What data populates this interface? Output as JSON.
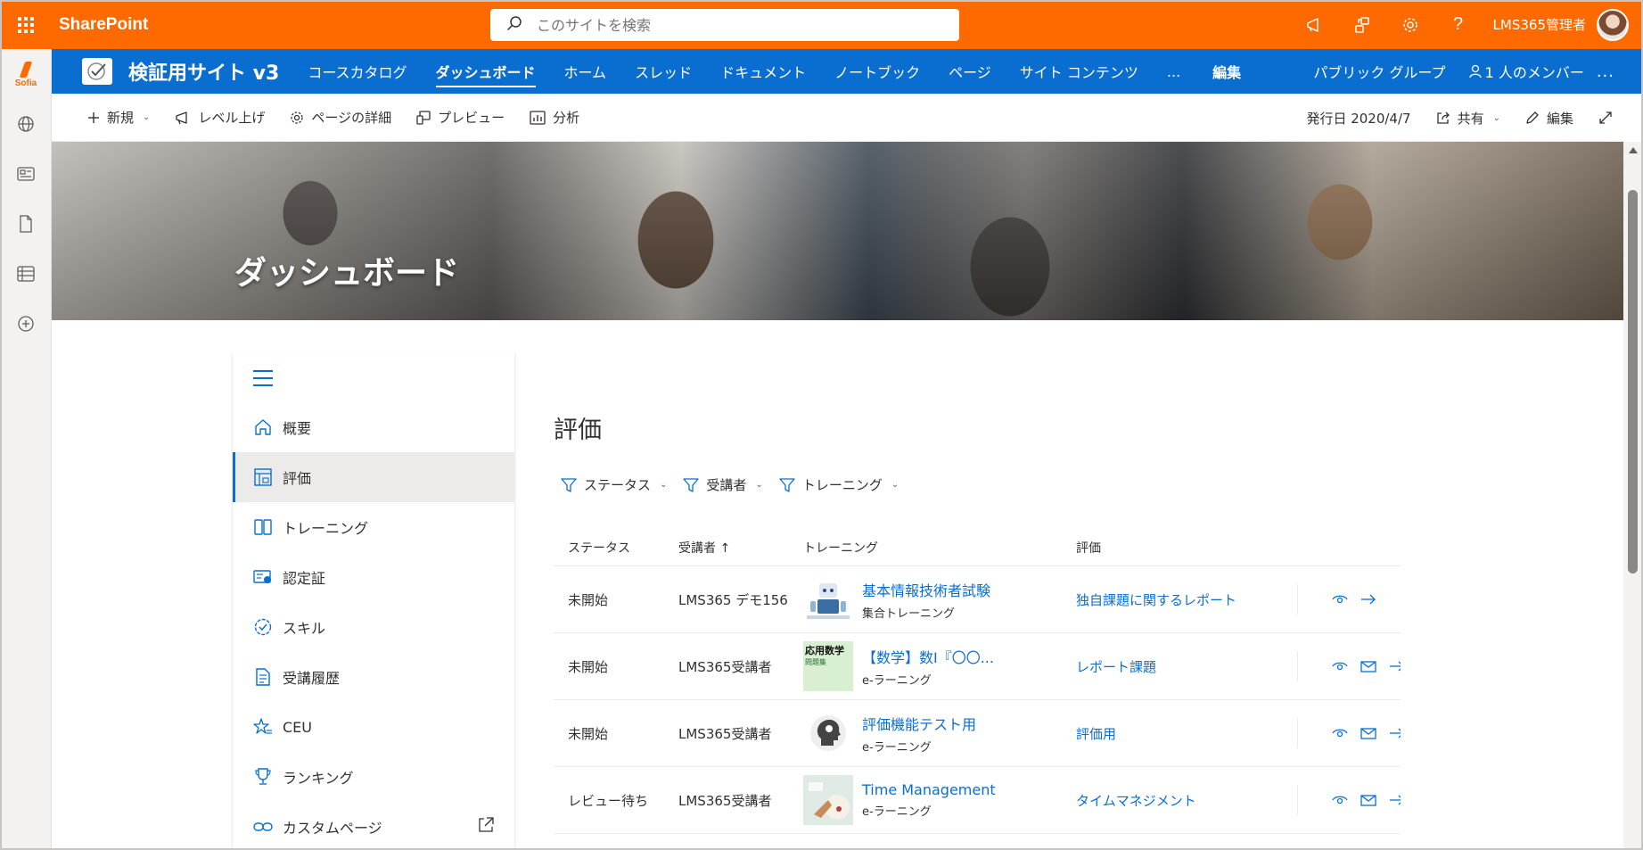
{
  "colors": {
    "suite_accent": "#ff6a00",
    "site_blue": "#0a6ed1",
    "link_blue": "#0a6ed1"
  },
  "suitebar": {
    "brand": "SharePoint",
    "search_placeholder": "このサイトを検索",
    "user_name": "LMS365管理者",
    "icons": [
      "waffle-icon",
      "megaphone-icon",
      "share-icon",
      "gear-icon",
      "help-icon"
    ]
  },
  "appbar": {
    "logo_text": "Sofia",
    "icons": [
      "globe-icon",
      "news-icon",
      "document-icon",
      "list-icon",
      "add-circle-icon"
    ]
  },
  "site": {
    "title": "検証用サイト v3",
    "nav": [
      {
        "label": "コースカタログ"
      },
      {
        "label": "ダッシュボード",
        "active": true
      },
      {
        "label": "ホーム"
      },
      {
        "label": "スレッド"
      },
      {
        "label": "ドキュメント"
      },
      {
        "label": "ノートブック"
      },
      {
        "label": "ページ"
      },
      {
        "label": "サイト コンテンツ"
      },
      {
        "label": "..."
      }
    ],
    "edit_label": "編集",
    "group_label": "パブリック グループ",
    "members_label": "1 人のメンバー",
    "more_label": "..."
  },
  "commandbar": {
    "new_label": "新規",
    "promote_label": "レベル上げ",
    "page_details_label": "ページの詳細",
    "preview_label": "プレビュー",
    "analytics_label": "分析",
    "published_label": "発行日 2020/4/7",
    "share_label": "共有",
    "edit_label": "編集"
  },
  "hero": {
    "title": "ダッシュボード"
  },
  "sidemenu": {
    "items": [
      {
        "label": "概要",
        "icon": "home-icon"
      },
      {
        "label": "評価",
        "icon": "assessment-icon",
        "active": true
      },
      {
        "label": "トレーニング",
        "icon": "book-icon"
      },
      {
        "label": "認定証",
        "icon": "certificate-icon"
      },
      {
        "label": "スキル",
        "icon": "skill-badge-icon"
      },
      {
        "label": "受講履歴",
        "icon": "history-icon"
      },
      {
        "label": "CEU",
        "icon": "star-list-icon"
      },
      {
        "label": "ランキング",
        "icon": "trophy-icon"
      },
      {
        "label": "カスタムページ",
        "icon": "link-icon"
      }
    ]
  },
  "main": {
    "heading": "評価",
    "filters": [
      "ステータス",
      "受講者",
      "トレーニング"
    ],
    "columns": [
      "ステータス",
      "受講者 ↑",
      "トレーニング",
      "評価"
    ],
    "rows": [
      {
        "status": "未開始",
        "user": "LMS365 デモ156",
        "training": "基本情報技術者試験",
        "type": "集合トレーニング",
        "evaluation": "独自課題に関するレポート",
        "thumb": "robot"
      },
      {
        "status": "未開始",
        "user": "LMS365受講者",
        "training": "【数学】数Ⅰ『〇〇...",
        "type": "e-ラーニング",
        "evaluation": "レポート課題",
        "thumb": "math",
        "thumb_title": "応用数学",
        "thumb_sub": "問題集"
      },
      {
        "status": "未開始",
        "user": "LMS365受講者",
        "training": "評価機能テスト用",
        "type": "e-ラーニング",
        "evaluation": "評価用",
        "thumb": "head"
      },
      {
        "status": "レビュー待ち",
        "user": "LMS365受講者",
        "training": "Time Management",
        "type": "e-ラーニング",
        "evaluation": "タイムマネジメント",
        "thumb": "time"
      }
    ]
  }
}
